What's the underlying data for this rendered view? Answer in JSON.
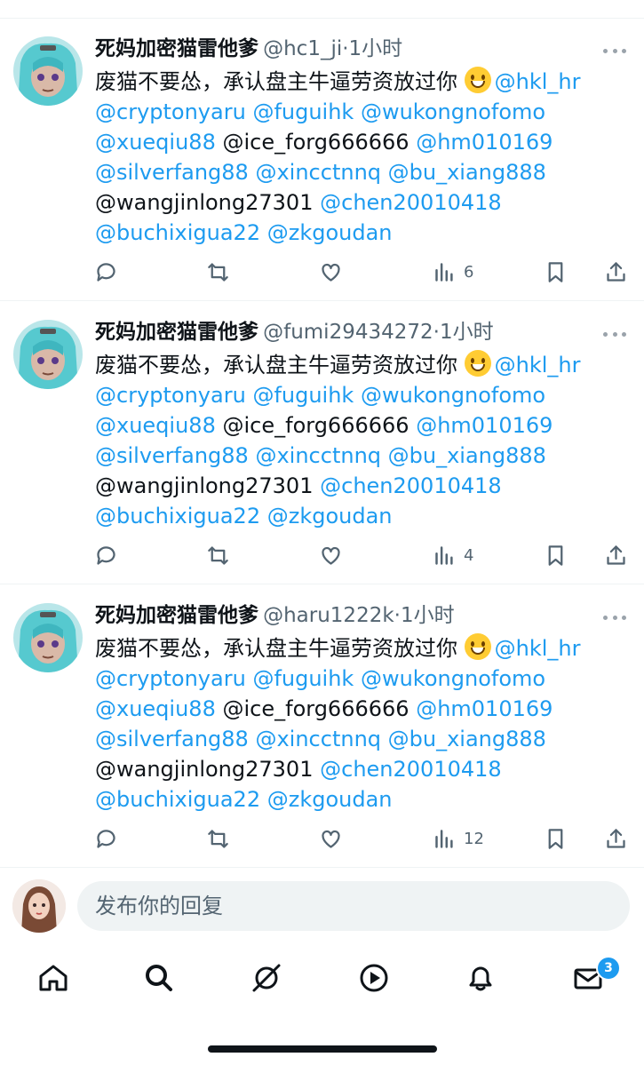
{
  "tweets": [
    {
      "name": "死妈加密猫雷他爹",
      "handle": "@hc1_ji",
      "sep": "·",
      "time": "1小时",
      "text_prefix": "废猫不要怂，承认盘主牛逼劳资放过你",
      "mention_1": "@hkl_hr",
      "line2": [
        "@cryptonyaru",
        "@fuguihk",
        "@wukongnofomo"
      ],
      "line3_a": "@xueqiu88",
      "line3_b": "@ice_forg666666",
      "line3_c": "@hm010169",
      "line4": [
        "@silverfang88",
        "@xincctnnq",
        "@bu_xiang888"
      ],
      "line5_a": "@wangjinlong27301",
      "line5_b": "@chen20010418",
      "line6": [
        "@buchixigua22",
        "@zkgoudan"
      ],
      "views": "6"
    },
    {
      "name": "死妈加密猫雷他爹",
      "handle": "@fumi29434272",
      "sep": "·",
      "time": "1小时",
      "text_prefix": "废猫不要怂，承认盘主牛逼劳资放过你",
      "mention_1": "@hkl_hr",
      "line2": [
        "@cryptonyaru",
        "@fuguihk",
        "@wukongnofomo"
      ],
      "line3_a": "@xueqiu88",
      "line3_b": "@ice_forg666666",
      "line3_c": "@hm010169",
      "line4": [
        "@silverfang88",
        "@xincctnnq",
        "@bu_xiang888"
      ],
      "line5_a": "@wangjinlong27301",
      "line5_b": "@chen20010418",
      "line6": [
        "@buchixigua22",
        "@zkgoudan"
      ],
      "views": "4"
    },
    {
      "name": "死妈加密猫雷他爹",
      "handle": "@haru1222k",
      "sep": "·",
      "time": "1小时",
      "text_prefix": "废猫不要怂，承认盘主牛逼劳资放过你",
      "mention_1": "@hkl_hr",
      "line2": [
        "@cryptonyaru",
        "@fuguihk",
        "@wukongnofomo"
      ],
      "line3_a": "@xueqiu88",
      "line3_b": "@ice_forg666666",
      "line3_c": "@hm010169",
      "line4": [
        "@silverfang88",
        "@xincctnnq",
        "@bu_xiang888"
      ],
      "line5_a": "@wangjinlong27301",
      "line5_b": "@chen20010418",
      "line6": [
        "@buchixigua22",
        "@zkgoudan"
      ],
      "views": "12"
    }
  ],
  "reply": {
    "placeholder": "发布你的回复"
  },
  "nav": {
    "messages_badge": "3"
  },
  "colors": {
    "accent": "#1d9bf0",
    "text": "#0f1419",
    "muted": "#536471"
  }
}
